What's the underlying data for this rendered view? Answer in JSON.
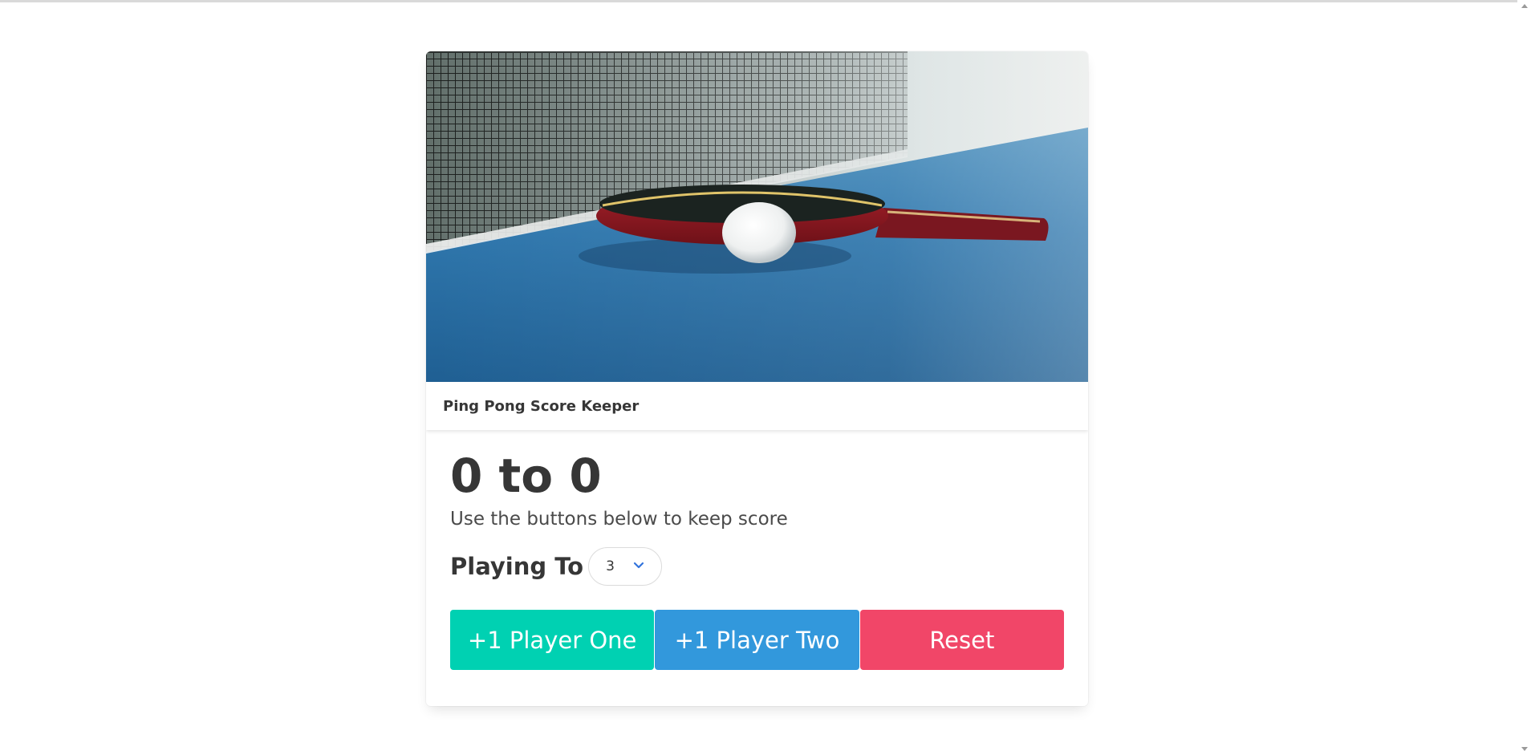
{
  "card": {
    "header_title": "Ping Pong Score Keeper",
    "image_alt": "ping-pong-table-photo"
  },
  "score": {
    "display": "0 to 0",
    "player_one": 0,
    "player_two": 0
  },
  "subtitle": "Use the buttons below to keep score",
  "playing_to": {
    "label": "Playing To",
    "selected": "3"
  },
  "buttons": {
    "player_one": "+1 Player One",
    "player_two": "+1 Player Two",
    "reset": "Reset"
  },
  "colors": {
    "player_one": "#00d1b2",
    "player_two": "#3298dc",
    "reset": "#f14668",
    "select_chevron": "#3273dc"
  },
  "icons": {
    "select_chevron": "chevron-down-icon"
  }
}
